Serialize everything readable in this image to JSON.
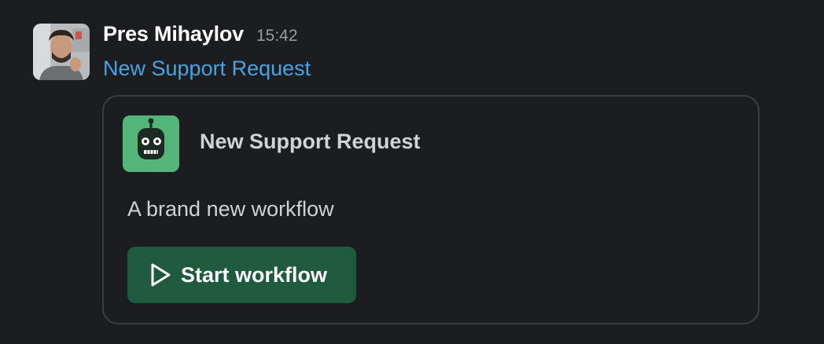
{
  "message": {
    "sender": "Pres Mihaylov",
    "timestamp": "15:42",
    "link_text": "New Support Request"
  },
  "card": {
    "title": "New Support Request",
    "description": "A brand new workflow",
    "button_label": "Start workflow",
    "button_icon": "play-icon",
    "app_icon": "robot-icon"
  },
  "colors": {
    "background": "#1b1d21",
    "link": "#4aa3e0",
    "button": "#1f5a3e",
    "app_icon_bg": "#54b57b",
    "card_border": "#3b3d42"
  }
}
